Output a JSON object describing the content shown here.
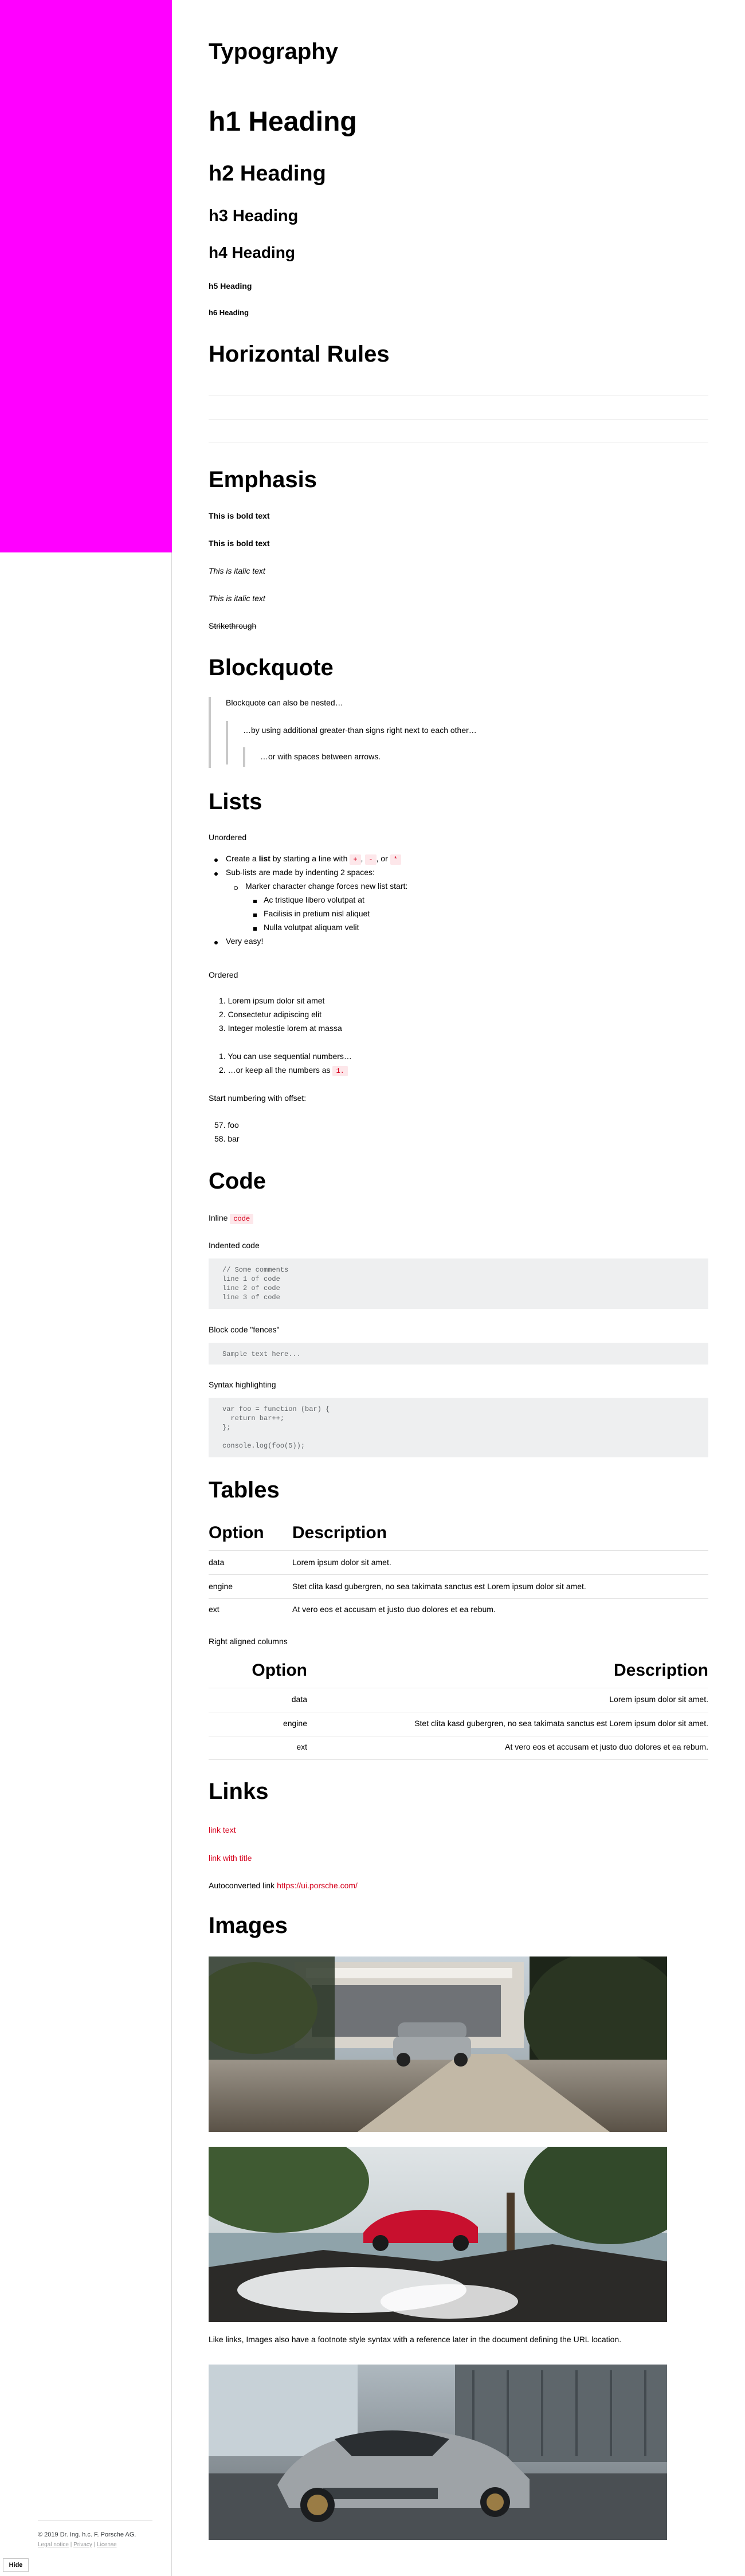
{
  "sidebar": {
    "copyright": "© 2019 Dr. Ing. h.c. F. Porsche AG.",
    "legal_notice": "Legal notice",
    "sep": " | ",
    "privacy": "Privacy",
    "license": "License",
    "hide_label": "Hide"
  },
  "page": {
    "title": "Typography"
  },
  "headings": {
    "h1": "h1 Heading",
    "h2": "h2 Heading",
    "h3": "h3 Heading",
    "h4": "h4 Heading",
    "h5": "h5 Heading",
    "h6": "h6 Heading"
  },
  "sections": {
    "hr": "Horizontal Rules",
    "emphasis": "Emphasis",
    "blockquote": "Blockquote",
    "lists": "Lists",
    "code": "Code",
    "tables": "Tables",
    "links": "Links",
    "images": "Images"
  },
  "emphasis": {
    "bold1": "This is bold text",
    "bold2": "This is bold text",
    "italic1": "This is italic text",
    "italic2": "This is italic text",
    "strike": "Strikethrough"
  },
  "blockquote": {
    "l1": "Blockquote can also be nested…",
    "l2": "…by using additional greater-than signs right next to each other…",
    "l3": "…or with spaces between arrows."
  },
  "lists": {
    "unordered_label": "Unordered",
    "item1_pre": "Create a ",
    "item1_bold": "list",
    "item1_post": " by starting a line with ",
    "mark_plus": "+",
    "mark_minus": "-",
    "mark_star": "*",
    "comma": ",",
    "or": ", or",
    "item2": "Sub-lists are made by indenting 2 spaces:",
    "item2a": "Marker character change forces new list start:",
    "item2a1": "Ac tristique libero volutpat at",
    "item2a2": "Facilisis in pretium nisl aliquet",
    "item2a3": "Nulla volutpat aliquam velit",
    "item3": "Very easy!",
    "ordered_label": "Ordered",
    "o1": "1. Lorem ipsum dolor sit amet",
    "o2": "2. Consectetur adipiscing elit",
    "o3": "3. Integer molestie lorem at massa",
    "o4": "1. You can use sequential numbers…",
    "o5": "2. …or keep all the numbers as ",
    "o5_code": "1.",
    "offset_label": "Start numbering with offset:",
    "off1": "57. foo",
    "off2": "58. bar"
  },
  "code": {
    "inline_label": "Inline ",
    "inline_code": "code",
    "indented_label": "Indented code",
    "indented": "// Some comments\nline 1 of code\nline 2 of code\nline 3 of code",
    "fences_label": "Block code \"fences\"",
    "fences": "Sample text here...",
    "syntax_label": "Syntax highlighting",
    "syntax": "var foo = function (bar) {\n  return bar++;\n};\n\nconsole.log(foo(5));"
  },
  "tables": {
    "col1": "Option",
    "col2": "Description",
    "rows": [
      {
        "option": "data",
        "desc": "Lorem ipsum dolor sit amet."
      },
      {
        "option": "engine",
        "desc": "Stet clita kasd gubergren, no sea takimata sanctus est Lorem ipsum dolor sit amet."
      },
      {
        "option": "ext",
        "desc": "At vero eos et accusam et justo duo dolores et ea rebum."
      }
    ],
    "right_label": "Right aligned columns"
  },
  "links": {
    "l1": "link text",
    "l2": "link with title",
    "auto_label": "Autoconverted link ",
    "auto_url": "https://ui.porsche.com/"
  },
  "images": {
    "footnote_text": "Like links, Images also have a footnote style syntax with a reference later in the document defining the URL location."
  }
}
